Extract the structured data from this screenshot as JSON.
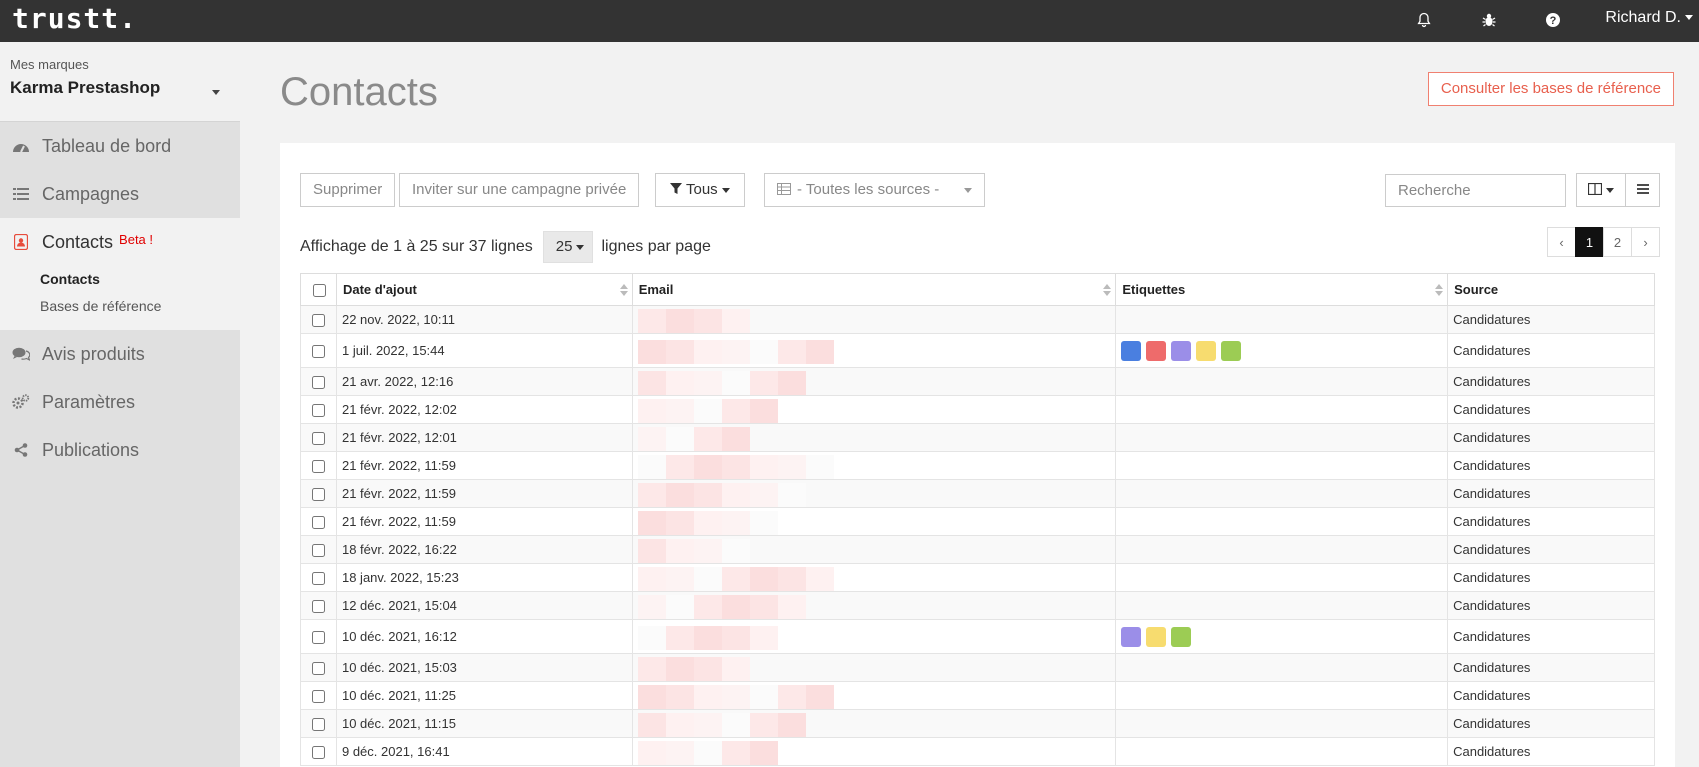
{
  "app": {
    "logo": "trustt.",
    "user": "Richard D."
  },
  "sidebar": {
    "brand_label": "Mes marques",
    "brand_name": "Karma Prestashop",
    "nav": [
      {
        "label": "Tableau de bord",
        "icon": "dashboard-icon"
      },
      {
        "label": "Campagnes",
        "icon": "list-icon"
      },
      {
        "label": "Contacts",
        "icon": "contact-card-icon",
        "badge": "Beta !"
      },
      {
        "label": "Avis produits",
        "icon": "comments-icon"
      },
      {
        "label": "Paramètres",
        "icon": "gears-icon"
      },
      {
        "label": "Publications",
        "icon": "share-icon"
      }
    ],
    "subnav": [
      "Contacts",
      "Bases de référence"
    ]
  },
  "page": {
    "title": "Contacts",
    "ref_button": "Consulter les bases de référence"
  },
  "toolbar": {
    "delete": "Supprimer",
    "invite": "Inviter sur une campagne privée",
    "filter": "Tous",
    "sources": "- Toutes les sources -",
    "search_placeholder": "Recherche"
  },
  "listing": {
    "info_prefix": "Affichage de 1 à 25 sur 37 lignes",
    "per_page": "25",
    "info_suffix": "lignes par page",
    "pages": [
      "‹",
      "1",
      "2",
      "›"
    ],
    "current_page": "1"
  },
  "table": {
    "columns": [
      "Date d'ajout",
      "Email",
      "Etiquettes",
      "Source"
    ],
    "tag_colors": {
      "blue": "#4a7fe0",
      "red": "#ee6b6b",
      "purple": "#9b8ee8",
      "yellow": "#f7dc6f",
      "green": "#9ccc54"
    },
    "rows": [
      {
        "date": "22 nov. 2022, 10:11",
        "tags": [],
        "source": "Candidatures"
      },
      {
        "date": "1 juil. 2022, 15:44",
        "tags": [
          "blue",
          "red",
          "purple",
          "yellow",
          "green"
        ],
        "source": "Candidatures"
      },
      {
        "date": "21 avr. 2022, 12:16",
        "tags": [],
        "source": "Candidatures"
      },
      {
        "date": "21 févr. 2022, 12:02",
        "tags": [],
        "source": "Candidatures"
      },
      {
        "date": "21 févr. 2022, 12:01",
        "tags": [],
        "source": "Candidatures"
      },
      {
        "date": "21 févr. 2022, 11:59",
        "tags": [],
        "source": "Candidatures"
      },
      {
        "date": "21 févr. 2022, 11:59",
        "tags": [],
        "source": "Candidatures"
      },
      {
        "date": "21 févr. 2022, 11:59",
        "tags": [],
        "source": "Candidatures"
      },
      {
        "date": "18 févr. 2022, 16:22",
        "tags": [],
        "source": "Candidatures"
      },
      {
        "date": "18 janv. 2022, 15:23",
        "tags": [],
        "source": "Candidatures"
      },
      {
        "date": "12 déc. 2021, 15:04",
        "tags": [],
        "source": "Candidatures"
      },
      {
        "date": "10 déc. 2021, 16:12",
        "tags": [
          "purple",
          "yellow",
          "green"
        ],
        "source": "Candidatures"
      },
      {
        "date": "10 déc. 2021, 15:03",
        "tags": [],
        "source": "Candidatures"
      },
      {
        "date": "10 déc. 2021, 11:25",
        "tags": [],
        "source": "Candidatures"
      },
      {
        "date": "10 déc. 2021, 11:15",
        "tags": [],
        "source": "Candidatures"
      },
      {
        "date": "9 déc. 2021, 16:41",
        "tags": [],
        "source": "Candidatures"
      }
    ]
  }
}
